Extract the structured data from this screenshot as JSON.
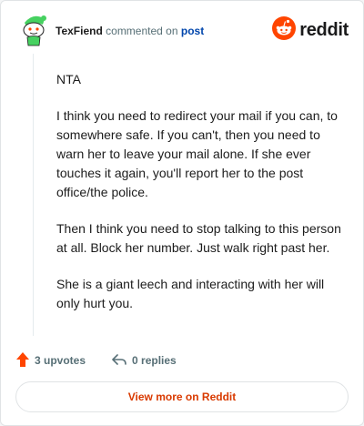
{
  "header": {
    "author": "TexFiend",
    "action_text": "commented on",
    "post_link": "post",
    "brand": "reddit"
  },
  "comment": {
    "paragraphs": [
      "NTA",
      "I think you need to redirect your mail if you can, to somewhere safe. If you can't, then you need to warn her to leave your mail alone. If she ever touches it again, you'll report her to the post office/the police.",
      "Then I think you need to stop talking to this person at all. Block her number. Just walk right past her.",
      "She is a giant leech and interacting with her will only hurt you."
    ]
  },
  "actions": {
    "upvotes": "3 upvotes",
    "replies": "0 replies"
  },
  "footer": {
    "view_more": "View more on Reddit"
  },
  "colors": {
    "brand_orange": "#ff4500",
    "link_blue": "#0045ac",
    "cta_orange": "#d93a00",
    "upvote_arrow": "#ff4500",
    "avatar_green": "#46d160"
  },
  "icons": [
    "avatar-snoo-icon",
    "reddit-logo-icon",
    "upvote-arrow-icon",
    "reply-icon"
  ]
}
